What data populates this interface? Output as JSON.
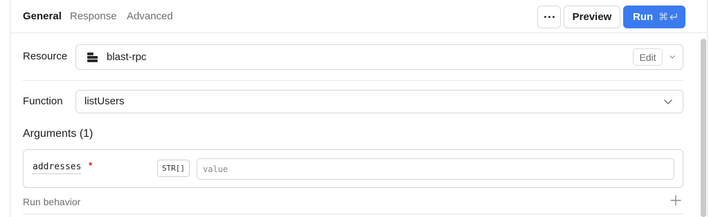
{
  "tabs": [
    {
      "label": "General",
      "active": true
    },
    {
      "label": "Response",
      "active": false
    },
    {
      "label": "Advanced",
      "active": false
    }
  ],
  "toolbar": {
    "more_icon": "ellipsis-icon",
    "preview_label": "Preview",
    "run_label": "Run",
    "run_shortcut": "⌘",
    "run_shortcut_icon": "return-icon"
  },
  "resource": {
    "label": "Resource",
    "name": "blast-rpc",
    "icon": "server-icon",
    "edit_label": "Edit"
  },
  "function": {
    "label": "Function",
    "value": "listUsers"
  },
  "arguments": {
    "heading": "Arguments (1)",
    "items": [
      {
        "name": "addresses",
        "required_mark": "*",
        "type": "STR[]",
        "placeholder": "value",
        "value": ""
      }
    ]
  },
  "run_behavior": {
    "label": "Run behavior",
    "icon": "plus-icon"
  },
  "colors": {
    "accent": "#3a7bf0",
    "required": "#d8312f"
  }
}
